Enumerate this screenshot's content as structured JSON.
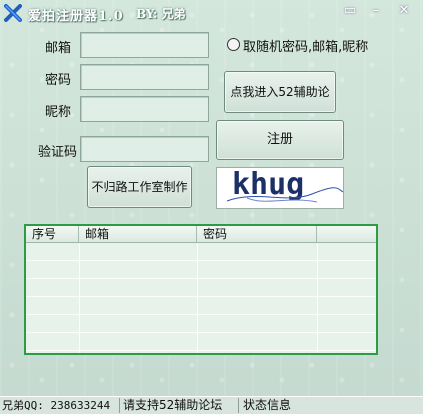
{
  "window": {
    "title": "爱拍注册器1.0",
    "author_tag": "BY: 兄弟",
    "buttons": {
      "skin": "▭",
      "minimize": "–",
      "close": "✕"
    }
  },
  "form": {
    "email_label": "邮箱",
    "password_label": "密码",
    "nickname_label": "昵称",
    "captcha_label": "验证码",
    "email_value": "",
    "password_value": "",
    "nickname_value": "",
    "captcha_value": "",
    "random_option_label": "取随机密码,邮箱,昵称",
    "random_option_checked": false
  },
  "buttons": {
    "forum": "点我进入52辅助论坛",
    "register": "注册",
    "studio": "不归路工作室制作"
  },
  "captcha_image": {
    "text": "khug"
  },
  "table": {
    "columns": [
      "序号",
      "邮箱",
      "密码",
      ""
    ],
    "rows": []
  },
  "status_bar": {
    "qq": "兄弟QQ: 238633244",
    "support": "请支持52辅助论坛",
    "status": "状态信息"
  },
  "colors": {
    "list_border": "#2d9b43",
    "title_text": "#ffffff",
    "captcha_text": "#1c2f66"
  }
}
